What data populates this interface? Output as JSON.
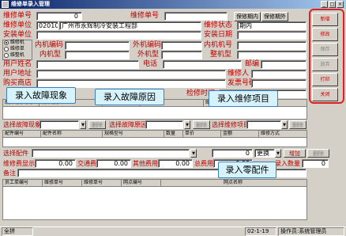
{
  "window": {
    "title": "维修单录入管理"
  },
  "form": {
    "order_no_label": "维修单号",
    "order_no_value": "0",
    "order_no2_label": "维修单号",
    "repair_unit_label": "维修单位",
    "repair_unit_code": "020102",
    "repair_unit_name": "广州市永辉制冷安装工程部",
    "install_unit_label": "安装单位",
    "repair_status_label": "维修状态",
    "repair_status_value": "期内",
    "install_date_label": "安装日期",
    "inner_code_label": "内机编码",
    "outer_code_label": "外机编码",
    "inner_no_label": "内机机号",
    "inner_model_label": "内机型",
    "outer_model_label": "外机型",
    "whole_no_label": "整机型",
    "mail_label": "邮编",
    "radio1": "维修机",
    "radio2": "维修单",
    "radio3": "维整机",
    "user_name_label": "用户姓名",
    "phone_label": "电话",
    "user_addr_label": "用户地址",
    "repairer_label": "维修人",
    "buy_store_label": "购买商店",
    "invoice_label": "发票号码",
    "check_time_label": "检修时间"
  },
  "top_buttons": {
    "out_warranty": "保修期内",
    "in_warranty": "保修期外"
  },
  "side_buttons": [
    {
      "label": "新增",
      "disabled": false
    },
    {
      "label": "修改",
      "disabled": false
    },
    {
      "label": "保存",
      "disabled": true
    },
    {
      "label": "放弃",
      "disabled": true
    },
    {
      "label": "打印",
      "disabled": false
    },
    {
      "label": "关闭",
      "disabled": false
    }
  ],
  "callouts": {
    "fault_phenomenon": "录入故障现象",
    "fault_reason": "录入故障原因",
    "repair_items": "录入维修项目",
    "parts": "录入零配件"
  },
  "fault_grid": {
    "col1": "故障现象编号",
    "col2": "故障现象",
    "col3": "故障原因编号",
    "col4": "故障原因",
    "col5": "维修项目"
  },
  "selectors": {
    "select_fault": "选择故障现象",
    "select_reason": "选择故障原因",
    "select_item": "选择维修项目",
    "delete": "删除"
  },
  "parts_grid": {
    "col1": "配件编号",
    "col2": "配件名称",
    "col3": "规格型号",
    "col4": "数量",
    "col5": "单价",
    "col6": "金额",
    "col7": "维修方式"
  },
  "parts_bar": {
    "select_parts": "选择配件",
    "qty_value": "0",
    "mode_value": "更换",
    "add": "增加",
    "delete": "删除"
  },
  "fees": {
    "repair_fee_label": "维修费显示",
    "repair_fee_value": "0.00",
    "traffic_label": "交通费",
    "traffic_value": "0.00",
    "other_label": "其他费用",
    "other_value": "0.00",
    "total_label": "总费用",
    "total_value": "0.00",
    "count_label": "录入数量",
    "count_value": "0"
  },
  "remark_label": "备注",
  "staff_grid": {
    "col1": "员工单编号",
    "col2": "维修单号",
    "col3": "维修单号",
    "col4": "网点编号",
    "col5": "网点名称"
  },
  "statusbar": {
    "mode": "全拼",
    "date": "02-1-19",
    "operator": "操作员:系统管理员"
  }
}
